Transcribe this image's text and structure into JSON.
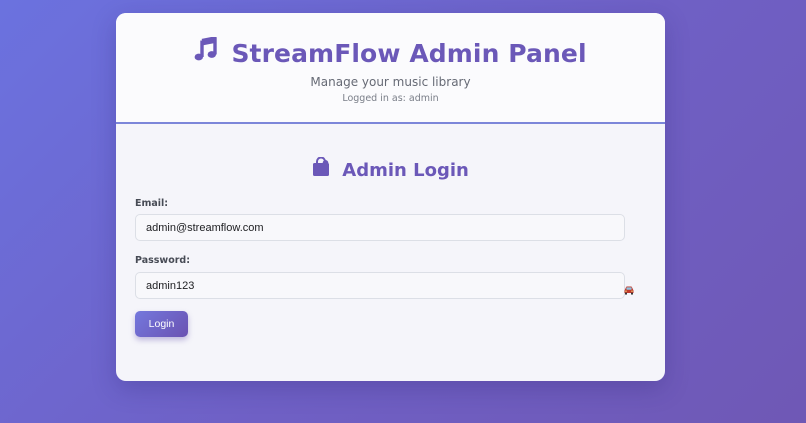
{
  "header": {
    "title": "StreamFlow Admin Panel",
    "subtitle": "Manage your music library",
    "logged_in_text": "Logged in as: admin",
    "title_icon": "music-note-icon"
  },
  "login": {
    "title": "Admin Login",
    "title_icon": "shopping-bag-icon",
    "email_label": "Email:",
    "email_value": "admin@streamflow.com",
    "password_label": "Password:",
    "password_value": "admin123",
    "toggle_icon": "car-icon",
    "button_label": "Login"
  },
  "colors": {
    "accent": "#6b58b8",
    "background_start": "#6b72df",
    "background_end": "#6f58b5",
    "divider": "#7c86d9",
    "button_start": "#7478dd",
    "button_end": "#6a52b2"
  }
}
